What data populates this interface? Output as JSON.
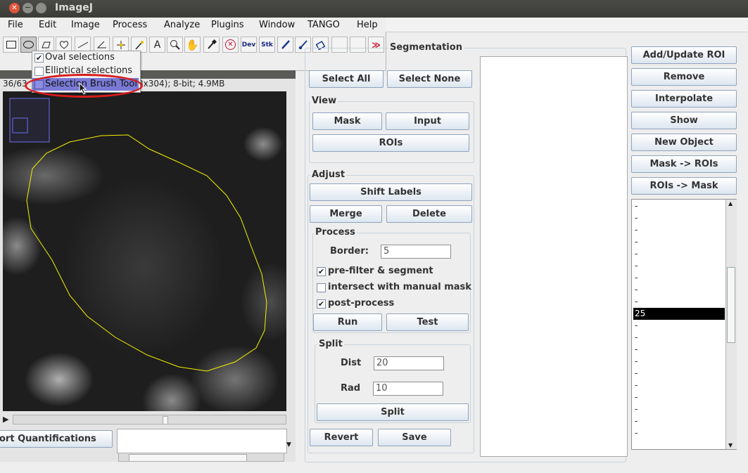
{
  "window": {
    "title": "ImageJ"
  },
  "menu": [
    "File",
    "Edit",
    "Image",
    "Process",
    "Analyze",
    "Plugins",
    "Window",
    "TANGO",
    "Help"
  ],
  "toolbar": {
    "icons": [
      "rectangle-tool-icon",
      "oval-tool-icon",
      "polygon-tool-icon",
      "freehand-tool-icon",
      "line-tool-icon",
      "angle-tool-icon",
      "point-tool-icon",
      "wand-tool-icon",
      "text-tool-icon",
      "magnifier-icon",
      "hand-icon",
      "color-picker-icon",
      "stop-icon",
      "dev-icon",
      "stk-icon",
      "pencil-icon",
      "brush-icon",
      "flood-fill-icon",
      "blank-tool-icon",
      "blank-tool-icon",
      "more-tools-icon"
    ],
    "dev": "Dev",
    "stk": "Stk",
    "more": "≫"
  },
  "popup": {
    "items": [
      {
        "label": "Oval selections",
        "checked": true
      },
      {
        "label": "Elliptical selections",
        "checked": false
      },
      {
        "label": "Selection Brush Tool",
        "checked": false,
        "highlighted": true
      }
    ]
  },
  "image_window": {
    "info_left": "36/63",
    "info_right": "8x304); 8-bit; 4.9MB"
  },
  "bottom_left": {
    "button": "ort Quantifications"
  },
  "segmentation": {
    "title": "Segmentation",
    "select_all": "Select All",
    "select_none": "Select None",
    "view": {
      "label": "View",
      "mask": "Mask",
      "input": "Input",
      "rois": "ROIs"
    },
    "adjust": {
      "label": "Adjust",
      "shift_labels": "Shift Labels",
      "merge": "Merge",
      "delete": "Delete"
    },
    "process": {
      "label": "Process",
      "border_label": "Border:",
      "border_value": "5",
      "prefilter": "pre-filter & segment",
      "intersect": "intersect with manual mask",
      "postprocess": "post-process",
      "check_mark": "✔",
      "run": "Run",
      "test": "Test"
    },
    "split": {
      "label": "Split",
      "dist_label": "Dist",
      "dist_value": "20",
      "rad_label": "Rad",
      "rad_value": "10",
      "split_btn": "Split"
    },
    "revert": "Revert",
    "save": "Save"
  },
  "roi_panel": {
    "add_update": "Add/Update ROI",
    "remove": "Remove",
    "interpolate": "Interpolate",
    "show": "Show",
    "new_object": "New Object",
    "mask_to_rois": "Mask -> ROIs",
    "rois_to_mask": "ROIs -> Mask",
    "list": [
      "-",
      "-",
      "-",
      "-",
      "-",
      "-",
      "-",
      "-",
      "-",
      "25",
      "-",
      "-",
      "-",
      "-",
      "-",
      "-",
      "-",
      "-",
      "-",
      "-"
    ],
    "selected_index": 9
  }
}
